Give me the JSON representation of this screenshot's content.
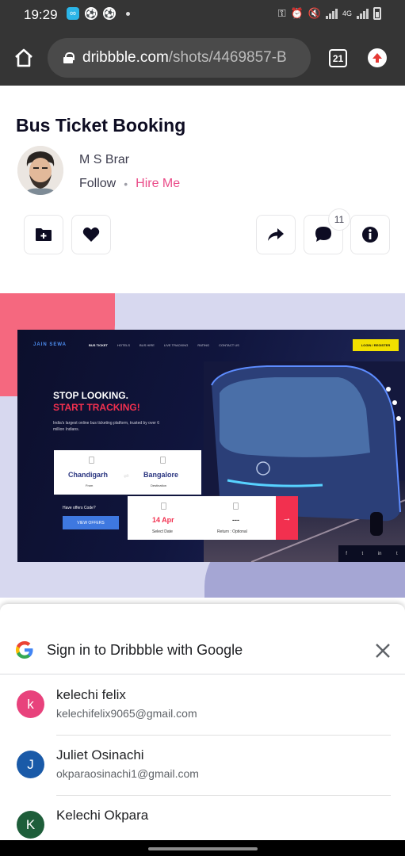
{
  "status_bar": {
    "time": "19:29",
    "network_label": "4G"
  },
  "browser": {
    "url_domain": "dribbble.com",
    "url_path": "/shots/4469857-B",
    "tab_count": "21"
  },
  "shot": {
    "title": "Bus Ticket Booking",
    "author_name": "M S Brar",
    "follow_label": "Follow",
    "separator": "•",
    "hire_label": "Hire Me",
    "comment_count": "11",
    "actions": [
      "save-collection",
      "like",
      "share",
      "comments",
      "details"
    ]
  },
  "mockup": {
    "logo": "JAIN SEWA",
    "nav": [
      "BUS TICKET",
      "HOTELS",
      "BUS HIRE",
      "LIVE TRACKING",
      "RATING",
      "CONTACT US"
    ],
    "login_label": "LOGIN / REGISTER",
    "headline_1": "STOP LOOKING.",
    "headline_2": "START TRACKING!",
    "subtext": "India's largest online bus ticketing platform, trusted by over 6 million Indians.",
    "from_city": "Chandigarh",
    "from_label": "From",
    "to_city": "Bangalore",
    "to_label": "Destination",
    "offer_text": "Have offers Code?",
    "view_offers": "VIEW OFFERS",
    "date_value": "14 Apr",
    "date_label": "Select Date",
    "return_value": "---",
    "return_label": "Return : Optional",
    "social": [
      "f",
      "t",
      "in",
      "t"
    ]
  },
  "google_signin": {
    "title": "Sign in to Dribbble with Google",
    "accounts": [
      {
        "initial": "k",
        "name": "kelechi felix",
        "email": "kelechifelix9065@gmail.com",
        "color": "#e8427c"
      },
      {
        "initial": "J",
        "name": "Juliet Osinachi",
        "email": "okparaosinachi1@gmail.com",
        "color": "#1a5aa8"
      },
      {
        "initial": "K",
        "name": "Kelechi Okpara",
        "email": "",
        "color": "#1e5e3a"
      }
    ]
  },
  "colors": {
    "brand_pink": "#ea4c89",
    "browser_chrome": "#353535",
    "cta_red": "#f2304f"
  }
}
